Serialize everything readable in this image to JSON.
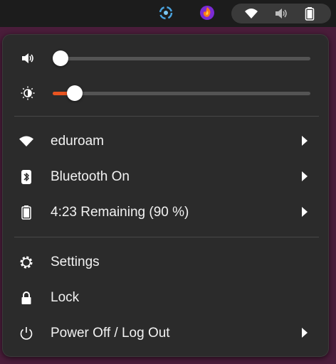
{
  "topbar": {
    "tray_icons": [
      "steam-tray-icon",
      "firefox-tray-icon"
    ],
    "status_icons": [
      "wifi-icon",
      "volume-muted-icon",
      "battery-icon"
    ]
  },
  "menu": {
    "volume": {
      "icon": "speaker-icon",
      "level": 0.0
    },
    "brightness": {
      "icon": "brightness-icon",
      "level": 0.06
    },
    "items": [
      {
        "icon": "wifi-icon",
        "label": "eduroam",
        "has_submenu": true
      },
      {
        "icon": "bluetooth-icon",
        "label": "Bluetooth On",
        "has_submenu": true
      },
      {
        "icon": "battery-icon",
        "label": "4:23 Remaining (90 %)",
        "has_submenu": true
      },
      {
        "icon": "gear-icon",
        "label": "Settings",
        "has_submenu": false
      },
      {
        "icon": "lock-icon",
        "label": "Lock",
        "has_submenu": false
      },
      {
        "icon": "power-icon",
        "label": "Power Off / Log Out",
        "has_submenu": true
      }
    ]
  },
  "colors": {
    "accent": "#e95420",
    "menu_bg": "#2b2b2b",
    "topbar_bg": "#1c1c1c",
    "text": "#f2f2f2"
  }
}
